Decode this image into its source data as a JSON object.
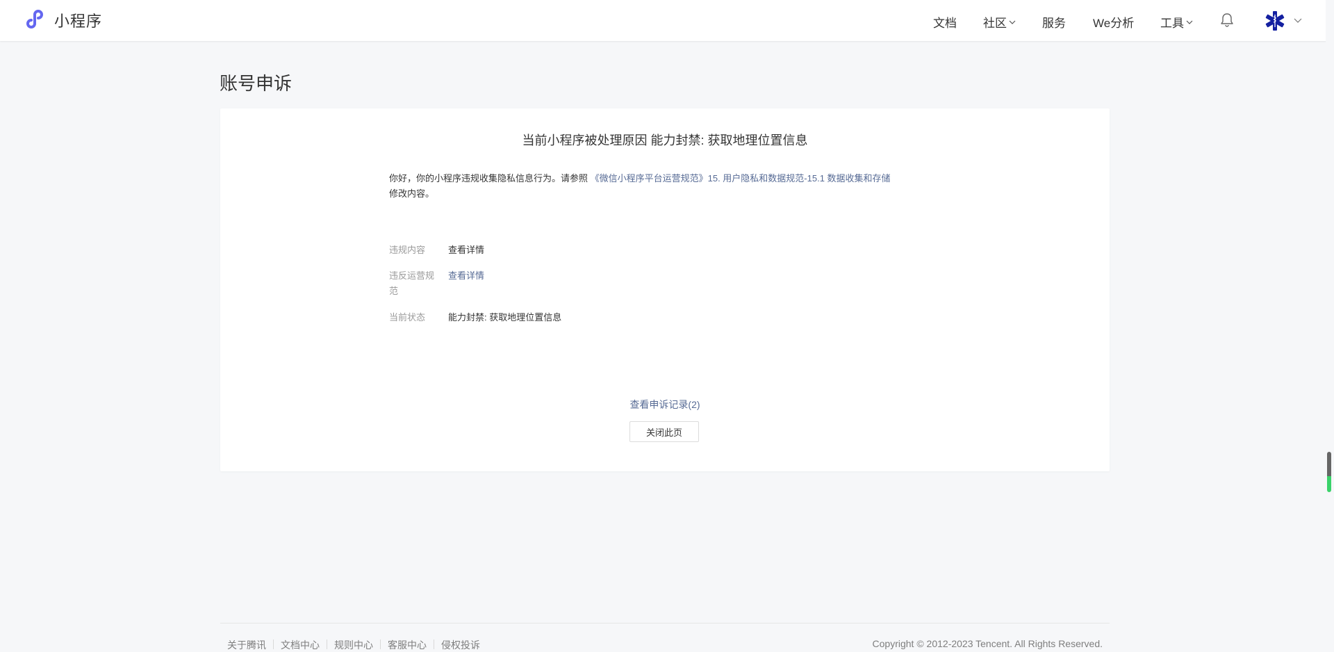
{
  "header": {
    "brand_name": "小程序",
    "nav": [
      {
        "label": "文档"
      },
      {
        "label": "社区"
      },
      {
        "label": "服务"
      },
      {
        "label": "We分析"
      },
      {
        "label": "工具"
      }
    ]
  },
  "page": {
    "title": "账号申诉"
  },
  "card": {
    "reason_title": "当前小程序被处理原因 能力封禁: 获取地理位置信息",
    "notice_prefix": "你好，你的小程序违规收集隐私信息行为。请参照 ",
    "notice_link": "《微信小程序平台运营规范》15. 用户隐私和数据规范-15.1 数据收集和存储",
    "notice_suffix": "修改内容。",
    "rows": [
      {
        "label": "违规内容",
        "value": "查看详情"
      },
      {
        "label": "违反运营规范",
        "value": "查看详情"
      },
      {
        "label": "当前状态",
        "value": "能力封禁: 获取地理位置信息"
      }
    ],
    "records_link": "查看申诉记录(2)",
    "close_button": "关闭此页"
  },
  "footer": {
    "links": [
      "关于腾讯",
      "文档中心",
      "规则中心",
      "客服中心",
      "侵权投诉"
    ],
    "copyright": "Copyright © 2012-2023 Tencent. All Rights Reserved."
  },
  "colors": {
    "link": "#576b95",
    "brand": "#6467f0",
    "background": "#f6f7f9"
  }
}
